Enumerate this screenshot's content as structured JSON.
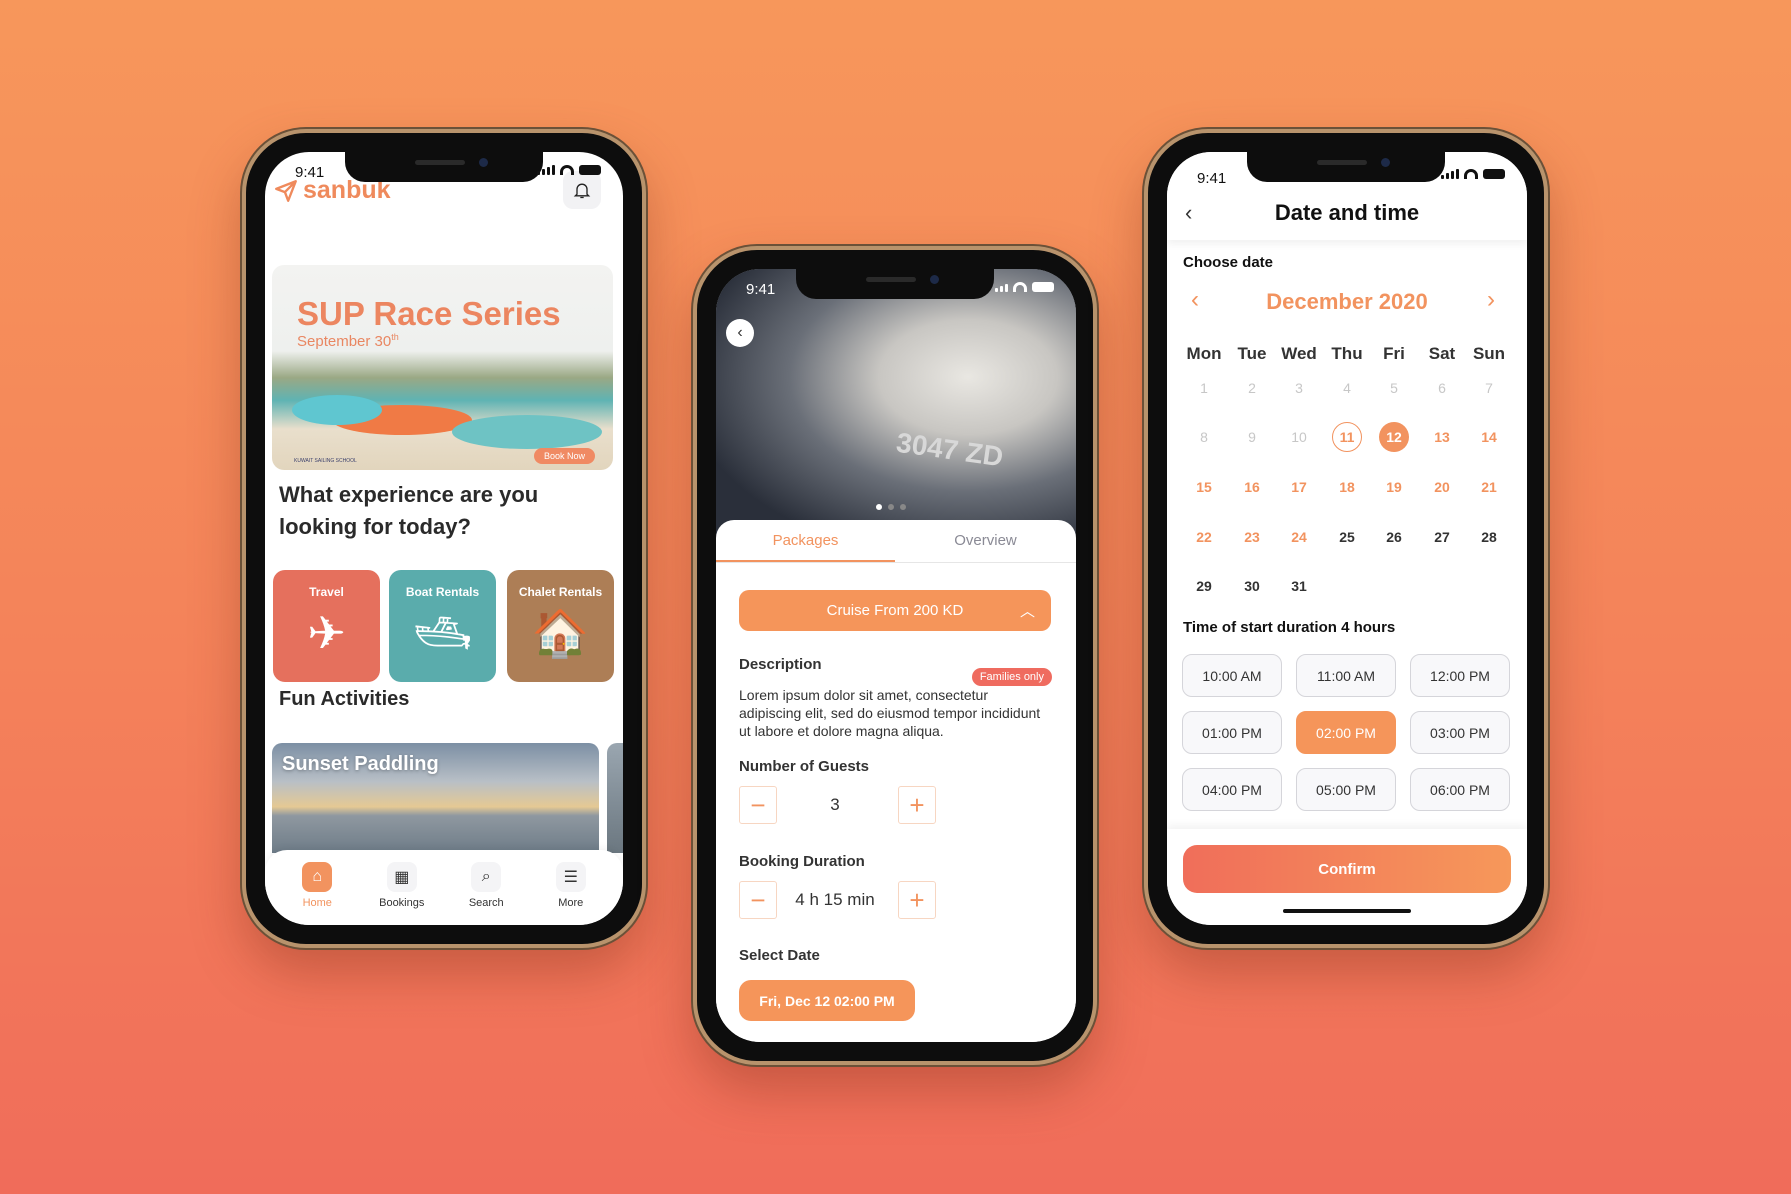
{
  "colors": {
    "accent": "#f2935f",
    "travel": "#e5705d",
    "boat": "#5aacac",
    "chalet": "#ad7e56",
    "badge": "#ef6b5f"
  },
  "status": {
    "time": "9:41"
  },
  "home": {
    "brand": "sanbuk",
    "banner": {
      "title": "SUP Race Series",
      "date": "September 30",
      "date_sup": "th",
      "cta": "Book Now",
      "school": "KUWAIT SAILING SCHOOL"
    },
    "question": "What experience are you looking for today?",
    "categories": [
      {
        "label": "Travel",
        "icon": "airplane-icon"
      },
      {
        "label": "Boat Rentals",
        "icon": "yacht-icon"
      },
      {
        "label": "Chalet Rentals",
        "icon": "chalet-icon"
      }
    ],
    "fun_title": "Fun Activities",
    "activities": [
      {
        "title": "Sunset Paddling"
      }
    ],
    "nav": [
      {
        "label": "Home",
        "icon": "home-icon",
        "active": true
      },
      {
        "label": "Bookings",
        "icon": "calendar-icon"
      },
      {
        "label": "Search",
        "icon": "search-icon"
      },
      {
        "label": "More",
        "icon": "menu-icon"
      }
    ]
  },
  "detail": {
    "boat_reg": "3047 ZD",
    "tabs": [
      "Packages",
      "Overview"
    ],
    "active_tab": "Packages",
    "package": "Cruise From 200 KD",
    "description_label": "Description",
    "badge": "Families only",
    "description": "Lorem ipsum dolor sit amet, consectetur adipiscing elit, sed do eiusmod tempor incididunt ut labore et dolore magna aliqua.",
    "guests_label": "Number of Guests",
    "guests": "3",
    "duration_label": "Booking Duration",
    "duration": "4 h 15 min",
    "date_label": "Select Date",
    "date_value": "Fri, Dec 12 02:00 PM"
  },
  "datetime": {
    "title": "Date and time",
    "choose_label": "Choose date",
    "month": "December 2020",
    "weekdays": [
      "Mon",
      "Tue",
      "Wed",
      "Thu",
      "Fri",
      "Sat",
      "Sun"
    ],
    "days": [
      {
        "d": "1",
        "s": "past"
      },
      {
        "d": "2",
        "s": "past"
      },
      {
        "d": "3",
        "s": "past"
      },
      {
        "d": "4",
        "s": "past"
      },
      {
        "d": "5",
        "s": "past"
      },
      {
        "d": "6",
        "s": "past"
      },
      {
        "d": "7",
        "s": "past"
      },
      {
        "d": "8",
        "s": "past"
      },
      {
        "d": "9",
        "s": "past"
      },
      {
        "d": "10",
        "s": "past"
      },
      {
        "d": "11",
        "s": "today"
      },
      {
        "d": "12",
        "s": "selected"
      },
      {
        "d": "13",
        "s": "available"
      },
      {
        "d": "14",
        "s": "available"
      },
      {
        "d": "15",
        "s": "available"
      },
      {
        "d": "16",
        "s": "available"
      },
      {
        "d": "17",
        "s": "available"
      },
      {
        "d": "18",
        "s": "available"
      },
      {
        "d": "19",
        "s": "available"
      },
      {
        "d": "20",
        "s": "available"
      },
      {
        "d": "21",
        "s": "available"
      },
      {
        "d": "22",
        "s": "available"
      },
      {
        "d": "23",
        "s": "available"
      },
      {
        "d": "24",
        "s": "available"
      },
      {
        "d": "25",
        "s": "default"
      },
      {
        "d": "26",
        "s": "default"
      },
      {
        "d": "27",
        "s": "default"
      },
      {
        "d": "28",
        "s": "default"
      },
      {
        "d": "29",
        "s": "default"
      },
      {
        "d": "30",
        "s": "default"
      },
      {
        "d": "31",
        "s": "default"
      }
    ],
    "time_label": "Time of start duration 4 hours",
    "slots": [
      "10:00 AM",
      "11:00 AM",
      "12:00 PM",
      "01:00 PM",
      "02:00 PM",
      "03:00 PM",
      "04:00 PM",
      "05:00 PM",
      "06:00 PM"
    ],
    "selected_slot": "02:00 PM",
    "confirm": "Confirm"
  }
}
